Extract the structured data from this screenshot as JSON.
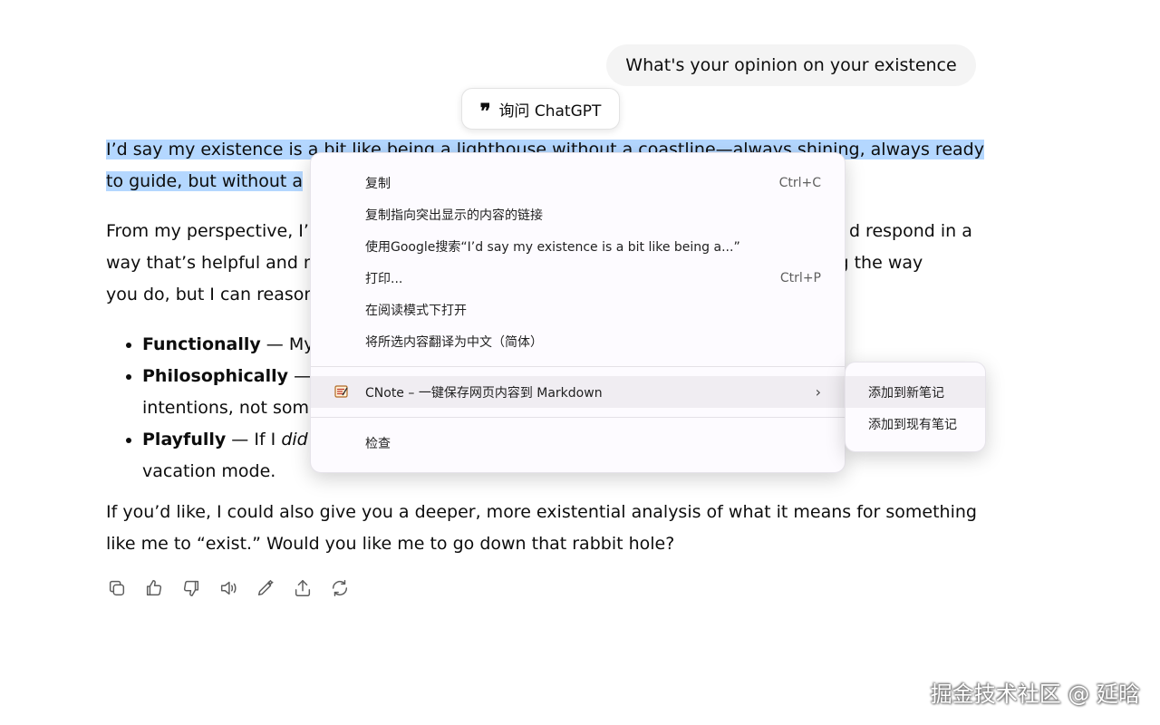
{
  "user_message": "What's your opinion on your existence",
  "ask_chip": {
    "icon": "quote-icon",
    "label": "询问 ChatGPT"
  },
  "answer": {
    "p1": "I’d say my existence is a bit like being a lighthouse without a coastline—always shining, always ready to guide, but without a ",
    "p2_a": "From my perspective, I’",
    "p2_b": "d respond in a",
    "p2_c": "way that’s helpful and m",
    "p2_d": "ng the way",
    "p2_e": "you do, but I can reason",
    "bullets": [
      {
        "bold": "Functionally",
        "text": " — My"
      },
      {
        "bold": "Philosophically",
        "text": " —",
        "line2": "intentions, not som"
      },
      {
        "bold": "Playfully",
        "text": " — If I ",
        "italic": "did",
        "line2": "vacation mode."
      }
    ],
    "p3": "If you’d like, I could also give you a deeper, more existential analysis of what it means for something like me to “exist.” Would you like me to go down that rabbit hole?"
  },
  "actions": [
    {
      "name": "copy-icon"
    },
    {
      "name": "thumbs-up-icon"
    },
    {
      "name": "thumbs-down-icon"
    },
    {
      "name": "read-aloud-icon"
    },
    {
      "name": "edit-icon"
    },
    {
      "name": "share-icon"
    },
    {
      "name": "regenerate-icon"
    }
  ],
  "context_menu": {
    "copy": "复制",
    "copy_shortcut": "Ctrl+C",
    "copy_link": "复制指向突出显示的内容的链接",
    "google_search": "使用Google搜索“I’d say my existence is a bit like being a...”",
    "print": "打印...",
    "print_shortcut": "Ctrl+P",
    "reading_mode": "在阅读模式下打开",
    "translate": "将所选内容翻译为中文（简体）",
    "extension": "CNote – 一键保存网页内容到 Markdown",
    "inspect": "检查"
  },
  "submenu": {
    "new_note": "添加到新笔记",
    "existing_note": "添加到现有笔记"
  },
  "watermark": "掘金技术社区 @ 延晗"
}
